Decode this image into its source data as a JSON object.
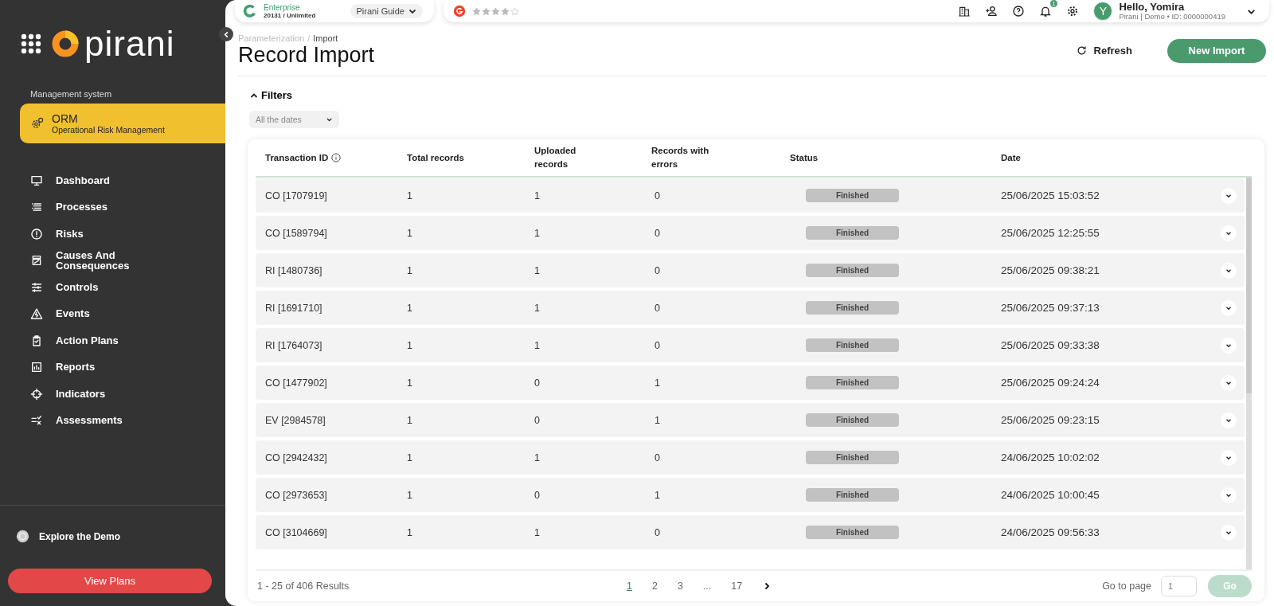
{
  "sidebar": {
    "brand": "pirani",
    "section_label": "Management system",
    "system": {
      "name": "ORM",
      "subtitle": "Operational Risk Management",
      "selected": true
    },
    "items": [
      {
        "label": "Dashboard"
      },
      {
        "label": "Processes"
      },
      {
        "label": "Risks"
      },
      {
        "label": "Causes And Consequences"
      },
      {
        "label": "Controls"
      },
      {
        "label": "Events"
      },
      {
        "label": "Action Plans"
      },
      {
        "label": "Reports"
      },
      {
        "label": "Indicators"
      },
      {
        "label": "Assessments"
      }
    ],
    "explore": "Explore the Demo",
    "plans_button": "View Plans"
  },
  "topbar": {
    "plan": "Enterprise",
    "plan_detail": "20131 / Unlimited",
    "guide": "Pirani Guide",
    "stars": 4,
    "notifications": "1",
    "avatar": "Y",
    "greeting": "Hello, Yomira",
    "account": "Pirani | Demo • ID: 0000000419"
  },
  "header": {
    "breadcrumb_parent": "Parameterization",
    "breadcrumb_sep": "/",
    "breadcrumb_current": "Import",
    "title": "Record Import",
    "refresh": "Refresh",
    "new_import": "New Import"
  },
  "filters": {
    "label": "Filters",
    "expanded": true,
    "date_select": "All the dates"
  },
  "table": {
    "columns": [
      "Transaction ID",
      "Total records",
      "Uploaded records",
      "Records with errors",
      "Status",
      "Date"
    ],
    "rows": [
      {
        "id": "CO [1707919]",
        "total": "1",
        "uploaded": "1",
        "errors": "0",
        "status": "Finished",
        "date": "25/06/2025 15:03:52"
      },
      {
        "id": "CO [1589794]",
        "total": "1",
        "uploaded": "1",
        "errors": "0",
        "status": "Finished",
        "date": "25/06/2025 12:25:55"
      },
      {
        "id": "RI [1480736]",
        "total": "1",
        "uploaded": "1",
        "errors": "0",
        "status": "Finished",
        "date": "25/06/2025 09:38:21"
      },
      {
        "id": "RI [1691710]",
        "total": "1",
        "uploaded": "1",
        "errors": "0",
        "status": "Finished",
        "date": "25/06/2025 09:37:13"
      },
      {
        "id": "RI [1764073]",
        "total": "1",
        "uploaded": "1",
        "errors": "0",
        "status": "Finished",
        "date": "25/06/2025 09:33:38"
      },
      {
        "id": "CO [1477902]",
        "total": "1",
        "uploaded": "0",
        "errors": "1",
        "status": "Finished",
        "date": "25/06/2025 09:24:24"
      },
      {
        "id": "EV [2984578]",
        "total": "1",
        "uploaded": "0",
        "errors": "1",
        "status": "Finished",
        "date": "25/06/2025 09:23:15"
      },
      {
        "id": "CO [2942432]",
        "total": "1",
        "uploaded": "1",
        "errors": "0",
        "status": "Finished",
        "date": "24/06/2025 10:02:02"
      },
      {
        "id": "CO [2973653]",
        "total": "1",
        "uploaded": "0",
        "errors": "1",
        "status": "Finished",
        "date": "24/06/2025 10:00:45"
      },
      {
        "id": "CO [3104669]",
        "total": "1",
        "uploaded": "1",
        "errors": "0",
        "status": "Finished",
        "date": "24/06/2025 09:56:33"
      }
    ]
  },
  "pagination": {
    "summary": "1 - 25 of 406 Results",
    "pages": [
      {
        "label": "1",
        "selected": true
      },
      {
        "label": "2",
        "selected": false
      },
      {
        "label": "3",
        "selected": false
      },
      {
        "label": "...",
        "selected": false
      },
      {
        "label": "17",
        "selected": false
      }
    ],
    "goto_label": "Go to page",
    "goto_placeholder": "1",
    "go": "Go",
    "go_disabled": true
  }
}
